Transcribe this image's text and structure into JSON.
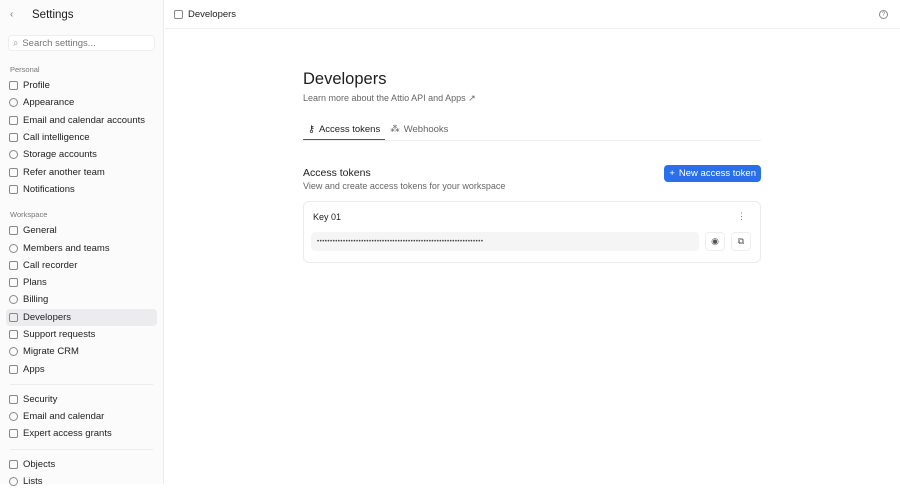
{
  "sidebar": {
    "title": "Settings",
    "search_placeholder": "Search settings...",
    "sections": [
      {
        "label": "Personal",
        "items": [
          "Profile",
          "Appearance",
          "Email and calendar accounts",
          "Call intelligence",
          "Storage accounts",
          "Refer another team",
          "Notifications"
        ]
      },
      {
        "label": "Workspace",
        "items": [
          "General",
          "Members and teams",
          "Call recorder",
          "Plans",
          "Billing",
          "Developers",
          "Support requests",
          "Migrate CRM",
          "Apps"
        ]
      },
      {
        "items": [
          "Security",
          "Email and calendar",
          "Expert access grants"
        ]
      },
      {
        "items": [
          "Objects",
          "Lists"
        ]
      }
    ],
    "active": "Developers"
  },
  "topbar": {
    "breadcrumb": "Developers"
  },
  "main": {
    "title": "Developers",
    "subtitle": "Learn more about the Attio API and Apps",
    "tabs": [
      "Access tokens",
      "Webhooks"
    ],
    "section_title": "Access tokens",
    "section_subtitle": "View and create access tokens for your workspace",
    "new_button": "New access token",
    "tokens": [
      {
        "name": "Key 01",
        "value": "••••••••••••••••••••••••••••••••••••••••••••••••••••••••••••••••"
      }
    ]
  },
  "colors": {
    "accent": "#2b6fe8"
  }
}
